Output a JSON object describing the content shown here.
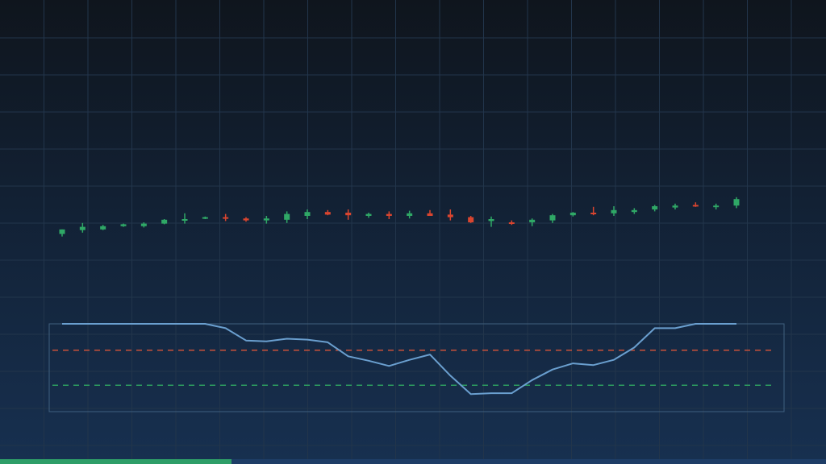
{
  "chart_data": [
    {
      "type": "candlestick",
      "grid": true,
      "up_color": "#2fa866",
      "down_color": "#d9452f",
      "candles": [
        {
          "o": 32.2,
          "h": 32.9,
          "l": 31.8,
          "c": 32.9
        },
        {
          "o": 32.8,
          "h": 33.9,
          "l": 32.4,
          "c": 33.3
        },
        {
          "o": 32.9,
          "h": 33.6,
          "l": 32.8,
          "c": 33.4
        },
        {
          "o": 33.4,
          "h": 33.8,
          "l": 33.3,
          "c": 33.7
        },
        {
          "o": 33.4,
          "h": 34.0,
          "l": 33.2,
          "c": 33.8
        },
        {
          "o": 33.8,
          "h": 34.5,
          "l": 33.7,
          "c": 34.4
        },
        {
          "o": 34.4,
          "h": 35.4,
          "l": 33.8,
          "c": 34.5
        },
        {
          "o": 34.6,
          "h": 34.9,
          "l": 34.5,
          "c": 34.8
        },
        {
          "o": 34.8,
          "h": 35.3,
          "l": 34.2,
          "c": 34.6
        },
        {
          "o": 34.6,
          "h": 34.8,
          "l": 34.1,
          "c": 34.3
        },
        {
          "o": 34.3,
          "h": 35.0,
          "l": 33.8,
          "c": 34.6
        },
        {
          "o": 34.4,
          "h": 35.7,
          "l": 33.9,
          "c": 35.3
        },
        {
          "o": 35.0,
          "h": 36.0,
          "l": 34.5,
          "c": 35.6
        },
        {
          "o": 35.6,
          "h": 35.9,
          "l": 35.1,
          "c": 35.2
        },
        {
          "o": 35.5,
          "h": 36.0,
          "l": 34.4,
          "c": 35.1
        },
        {
          "o": 35.0,
          "h": 35.5,
          "l": 34.7,
          "c": 35.3
        },
        {
          "o": 35.3,
          "h": 35.7,
          "l": 34.5,
          "c": 35.0
        },
        {
          "o": 35.0,
          "h": 35.8,
          "l": 34.6,
          "c": 35.4
        },
        {
          "o": 35.4,
          "h": 35.9,
          "l": 35.0,
          "c": 35.0
        },
        {
          "o": 35.2,
          "h": 36.0,
          "l": 34.3,
          "c": 34.8
        },
        {
          "o": 34.8,
          "h": 35.0,
          "l": 33.9,
          "c": 34.0
        },
        {
          "o": 34.2,
          "h": 34.9,
          "l": 33.3,
          "c": 34.5
        },
        {
          "o": 34.0,
          "h": 34.3,
          "l": 33.6,
          "c": 33.8
        },
        {
          "o": 34.0,
          "h": 34.6,
          "l": 33.4,
          "c": 34.4
        },
        {
          "o": 34.3,
          "h": 35.3,
          "l": 33.9,
          "c": 35.1
        },
        {
          "o": 35.1,
          "h": 35.6,
          "l": 34.9,
          "c": 35.5
        },
        {
          "o": 35.5,
          "h": 36.4,
          "l": 35.1,
          "c": 35.3
        },
        {
          "o": 35.4,
          "h": 36.5,
          "l": 35.0,
          "c": 35.9
        },
        {
          "o": 35.6,
          "h": 36.2,
          "l": 35.3,
          "c": 35.9
        },
        {
          "o": 36.0,
          "h": 36.7,
          "l": 35.7,
          "c": 36.5
        },
        {
          "o": 36.3,
          "h": 36.9,
          "l": 36.0,
          "c": 36.6
        },
        {
          "o": 36.7,
          "h": 37.1,
          "l": 36.4,
          "c": 36.5
        },
        {
          "o": 36.4,
          "h": 36.9,
          "l": 36.0,
          "c": 36.6
        },
        {
          "o": 36.6,
          "h": 37.9,
          "l": 36.2,
          "c": 37.6
        }
      ]
    },
    {
      "type": "line",
      "grid": true,
      "ylim": [
        0,
        100
      ],
      "series_color": "#6a9fcf",
      "values": [
        100,
        100,
        100,
        100,
        100,
        100,
        100,
        100,
        95,
        81,
        80,
        83,
        82,
        79,
        63,
        58,
        52,
        59,
        65,
        41,
        20,
        21,
        21,
        36,
        48,
        55,
        53,
        59,
        73,
        95,
        95,
        100,
        100,
        100
      ],
      "reference_lines": [
        {
          "value": 70,
          "color": "#c9503a"
        },
        {
          "value": 30,
          "color": "#2d9c5f"
        }
      ]
    }
  ],
  "progress": {
    "fraction": 0.28,
    "color": "#2e9e68"
  }
}
